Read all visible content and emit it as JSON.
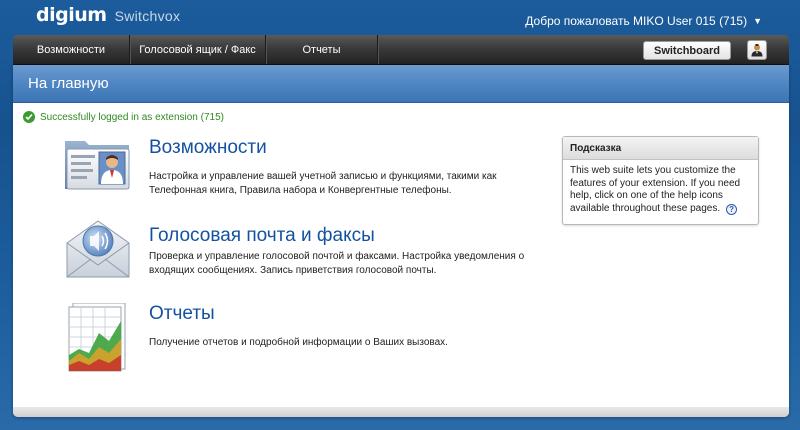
{
  "brand": {
    "logo": "digium",
    "product": "Switchvox"
  },
  "header": {
    "welcome": "Добро пожаловать MIKO User 015 (715)"
  },
  "nav": {
    "items": [
      {
        "label": "Возможности"
      },
      {
        "label": "Голосовой ящик / Факс"
      },
      {
        "label": "Отчеты"
      }
    ],
    "switchboard_label": "Switchboard"
  },
  "page": {
    "title": "На главную"
  },
  "status": {
    "message": "Successfully logged in as extension (715)",
    "color": "#2f8a1f"
  },
  "features": [
    {
      "title": "Возможности",
      "description": "Настройка и управление вашей учетной записью и функциями, такими как Телефонная книга, Правила набора и Конвергентные телефоны.",
      "icon": "user-card-icon"
    },
    {
      "title": "Голосовая почта и факсы",
      "description": "Проверка и управление голосовой почтой и факсами. Настройка уведомления о входящих сообщениях. Запись приветствия голосовой почты.",
      "icon": "voicemail-envelope-icon"
    },
    {
      "title": "Отчеты",
      "description": "Получение отчетов и подробной информации о Ваших вызовах.",
      "icon": "reports-chart-icon"
    }
  ],
  "hint": {
    "title": "Подсказка",
    "body": "This web suite lets you customize the features of your extension. If you need help, click on one of the help icons available throughout these pages.",
    "help_glyph": "?"
  },
  "colors": {
    "accent": "#1452a0",
    "navbar": "#333333",
    "crumb": "#4f86c3"
  }
}
